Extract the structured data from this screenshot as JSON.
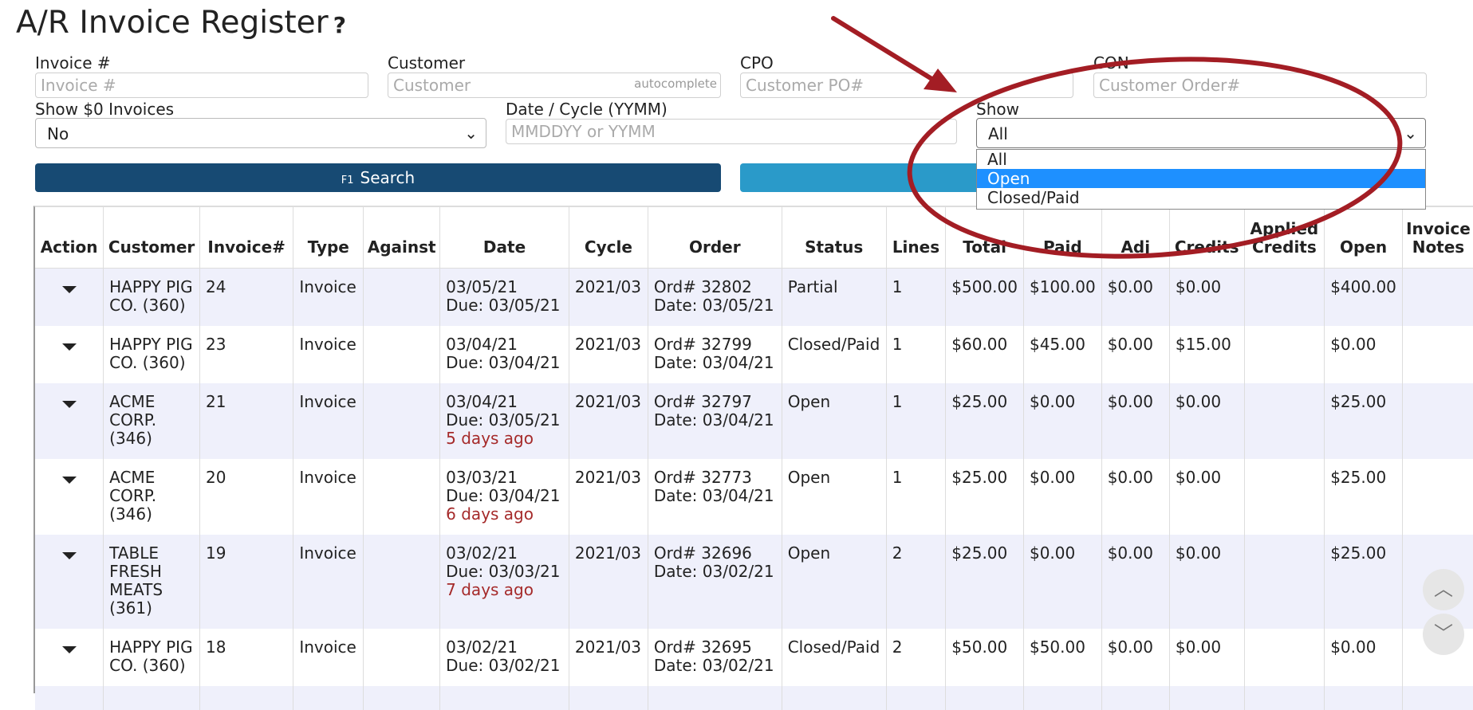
{
  "page": {
    "title": "A/R Invoice Register",
    "help": "?"
  },
  "filters": {
    "invoice": {
      "label": "Invoice #",
      "placeholder": "Invoice #"
    },
    "customer": {
      "label": "Customer",
      "placeholder": "Customer",
      "hint": "autocomplete"
    },
    "cpo": {
      "label": "CPO",
      "placeholder": "Customer PO#"
    },
    "con": {
      "label": "CON",
      "placeholder": "Customer Order#"
    },
    "show_zero": {
      "label": "Show $0 Invoices",
      "value": "No"
    },
    "date_cycle": {
      "label": "Date / Cycle (YYMM)",
      "placeholder": "MMDDYY or YYMM"
    },
    "show": {
      "label": "Show",
      "value": "All",
      "options": [
        "All",
        "Open",
        "Closed/Paid"
      ],
      "highlighted": "Open"
    }
  },
  "buttons": {
    "search_hotkey": "F1",
    "search_label": "Search"
  },
  "table": {
    "headers": [
      "Action",
      "Customer",
      "Invoice#",
      "Type",
      "Against",
      "Date",
      "Cycle",
      "Order",
      "Status",
      "Lines",
      "Total",
      "Paid",
      "Adj",
      "Credits",
      "Applied Credits",
      "Open",
      "Invoice Notes"
    ],
    "rows": [
      {
        "customer": [
          "HAPPY PIG",
          "CO. (360)"
        ],
        "invoice": "24",
        "type": "Invoice",
        "against": "",
        "date": "03/05/21",
        "due": "Due: 03/05/21",
        "ago": "",
        "cycle": "2021/03",
        "order": "Ord# 32802",
        "order_date": "Date: 03/05/21",
        "status": "Partial",
        "lines": "1",
        "total": "$500.00",
        "paid": "$100.00",
        "adj": "$0.00",
        "credits": "$0.00",
        "applied": "",
        "open": "$400.00",
        "notes": ""
      },
      {
        "customer": [
          "HAPPY PIG",
          "CO. (360)"
        ],
        "invoice": "23",
        "type": "Invoice",
        "against": "",
        "date": "03/04/21",
        "due": "Due: 03/04/21",
        "ago": "",
        "cycle": "2021/03",
        "order": "Ord# 32799",
        "order_date": "Date: 03/04/21",
        "status": "Closed/Paid",
        "lines": "1",
        "total": "$60.00",
        "paid": "$45.00",
        "adj": "$0.00",
        "credits": "$15.00",
        "applied": "",
        "open": "$0.00",
        "notes": ""
      },
      {
        "customer": [
          "ACME",
          "CORP.",
          "(346)"
        ],
        "invoice": "21",
        "type": "Invoice",
        "against": "",
        "date": "03/04/21",
        "due": "Due: 03/05/21",
        "ago": "5 days ago",
        "cycle": "2021/03",
        "order": "Ord# 32797",
        "order_date": "Date: 03/04/21",
        "status": "Open",
        "lines": "1",
        "total": "$25.00",
        "paid": "$0.00",
        "adj": "$0.00",
        "credits": "$0.00",
        "applied": "",
        "open": "$25.00",
        "notes": ""
      },
      {
        "customer": [
          "ACME",
          "CORP.",
          "(346)"
        ],
        "invoice": "20",
        "type": "Invoice",
        "against": "",
        "date": "03/03/21",
        "due": "Due: 03/04/21",
        "ago": "6 days ago",
        "cycle": "2021/03",
        "order": "Ord# 32773",
        "order_date": "Date: 03/04/21",
        "status": "Open",
        "lines": "1",
        "total": "$25.00",
        "paid": "$0.00",
        "adj": "$0.00",
        "credits": "$0.00",
        "applied": "",
        "open": "$25.00",
        "notes": ""
      },
      {
        "customer": [
          "TABLE",
          "FRESH",
          "MEATS",
          "(361)"
        ],
        "invoice": "19",
        "type": "Invoice",
        "against": "",
        "date": "03/02/21",
        "due": "Due: 03/03/21",
        "ago": "7 days ago",
        "cycle": "2021/03",
        "order": "Ord# 32696",
        "order_date": "Date: 03/02/21",
        "status": "Open",
        "lines": "2",
        "total": "$25.00",
        "paid": "$0.00",
        "adj": "$0.00",
        "credits": "$0.00",
        "applied": "",
        "open": "$25.00",
        "notes": ""
      },
      {
        "customer": [
          "HAPPY PIG",
          "CO. (360)"
        ],
        "invoice": "18",
        "type": "Invoice",
        "against": "",
        "date": "03/02/21",
        "due": "Due: 03/02/21",
        "ago": "",
        "cycle": "2021/03",
        "order": "Ord# 32695",
        "order_date": "Date: 03/02/21",
        "status": "Closed/Paid",
        "lines": "2",
        "total": "$50.00",
        "paid": "$50.00",
        "adj": "$0.00",
        "credits": "$0.00",
        "applied": "",
        "open": "$0.00",
        "notes": ""
      }
    ]
  },
  "scroll": {
    "up_icon": "chevron-up-icon",
    "down_icon": "chevron-down-icon"
  },
  "annotation": {
    "color": "#a31d24"
  }
}
